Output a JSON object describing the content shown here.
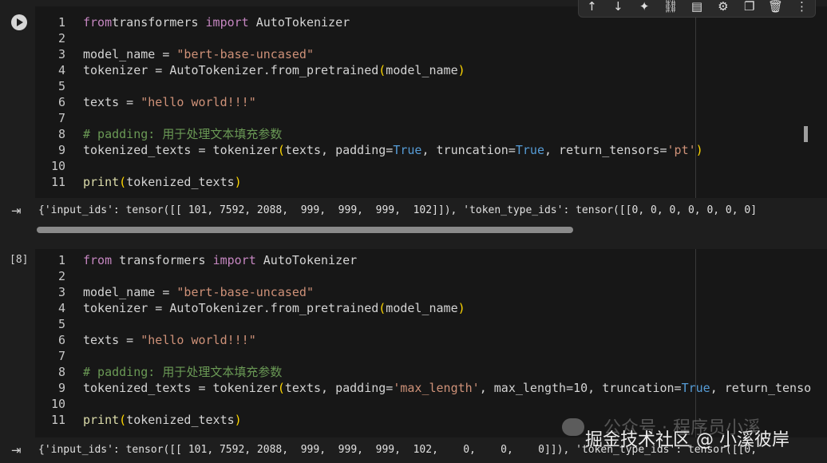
{
  "cell1": {
    "lines": [
      {
        "n": "1",
        "parts": [
          [
            "kw",
            "from"
          ],
          [
            "",
            "transformers "
          ],
          [
            "kw",
            "import"
          ],
          [
            "",
            " AutoTokenizer"
          ]
        ]
      },
      {
        "n": "2",
        "parts": []
      },
      {
        "n": "3",
        "parts": [
          [
            "",
            "model_name = "
          ],
          [
            "str",
            "\"bert-base-uncased\""
          ]
        ]
      },
      {
        "n": "4",
        "parts": [
          [
            "",
            "tokenizer = AutoTokenizer.from_pretrained"
          ],
          [
            "par",
            "("
          ],
          [
            "",
            "model_name"
          ],
          [
            "par",
            ")"
          ]
        ]
      },
      {
        "n": "5",
        "parts": []
      },
      {
        "n": "6",
        "parts": [
          [
            "",
            "texts = "
          ],
          [
            "str",
            "\"hello world!!!\""
          ]
        ]
      },
      {
        "n": "7",
        "parts": []
      },
      {
        "n": "8",
        "parts": [
          [
            "cm",
            "# padding: 用于处理文本填充参数"
          ]
        ]
      },
      {
        "n": "9",
        "parts": [
          [
            "",
            "tokenized_texts = tokenizer"
          ],
          [
            "par",
            "("
          ],
          [
            "",
            "texts, padding="
          ],
          [
            "const",
            "True"
          ],
          [
            "",
            ", truncation="
          ],
          [
            "const",
            "True"
          ],
          [
            "",
            ", return_tensors="
          ],
          [
            "str",
            "'pt'"
          ],
          [
            "par",
            ")"
          ]
        ]
      },
      {
        "n": "10",
        "parts": []
      },
      {
        "n": "11",
        "parts": [
          [
            "fn",
            "print"
          ],
          [
            "par",
            "("
          ],
          [
            "",
            "tokenized_texts"
          ],
          [
            "par",
            ")"
          ]
        ]
      }
    ],
    "output": "{'input_ids': tensor([[ 101, 7592, 2088,  999,  999,  999,  102]]), 'token_type_ids': tensor([[0, 0, 0, 0, 0, 0, 0]"
  },
  "cell2": {
    "exec_count": "[8]",
    "lines": [
      {
        "n": "1",
        "parts": [
          [
            "kw",
            "from"
          ],
          [
            "",
            " transformers "
          ],
          [
            "kw",
            "import"
          ],
          [
            "",
            " AutoTokenizer"
          ]
        ]
      },
      {
        "n": "2",
        "parts": []
      },
      {
        "n": "3",
        "parts": [
          [
            "",
            "model_name = "
          ],
          [
            "str",
            "\"bert-base-uncased\""
          ]
        ]
      },
      {
        "n": "4",
        "parts": [
          [
            "",
            "tokenizer = AutoTokenizer.from_pretrained"
          ],
          [
            "par",
            "("
          ],
          [
            "",
            "model_name"
          ],
          [
            "par",
            ")"
          ]
        ]
      },
      {
        "n": "5",
        "parts": []
      },
      {
        "n": "6",
        "parts": [
          [
            "",
            "texts = "
          ],
          [
            "str",
            "\"hello world!!!\""
          ]
        ]
      },
      {
        "n": "7",
        "parts": []
      },
      {
        "n": "8",
        "parts": [
          [
            "cm",
            "# padding: 用于处理文本填充参数"
          ]
        ]
      },
      {
        "n": "9",
        "parts": [
          [
            "",
            "tokenized_texts = tokenizer"
          ],
          [
            "par",
            "("
          ],
          [
            "",
            "texts, padding="
          ],
          [
            "str",
            "'max_length'"
          ],
          [
            "",
            ", max_length=10, truncation="
          ],
          [
            "const",
            "True"
          ],
          [
            "",
            ", return_tenso"
          ]
        ]
      },
      {
        "n": "10",
        "parts": []
      },
      {
        "n": "11",
        "parts": [
          [
            "fn",
            "print"
          ],
          [
            "par",
            "("
          ],
          [
            "",
            "tokenized_texts"
          ],
          [
            "par",
            ")"
          ]
        ]
      }
    ],
    "output": "{'input_ids': tensor([[ 101, 7592, 2088,  999,  999,  999,  102,    0,    0,    0]]), 'token_type_ids': tensor([[0,"
  },
  "toolbar": {
    "icons": [
      "arrow-up-icon",
      "arrow-down-icon",
      "sparkle-icon",
      "link-icon",
      "comment-icon",
      "gear-icon",
      "mirror-cell-icon",
      "trash-icon",
      "more-vert-icon"
    ]
  },
  "watermark": {
    "line1": "公众号 · 程序员小溪",
    "line2": "掘金技术社区 @ 小溪彼岸"
  }
}
